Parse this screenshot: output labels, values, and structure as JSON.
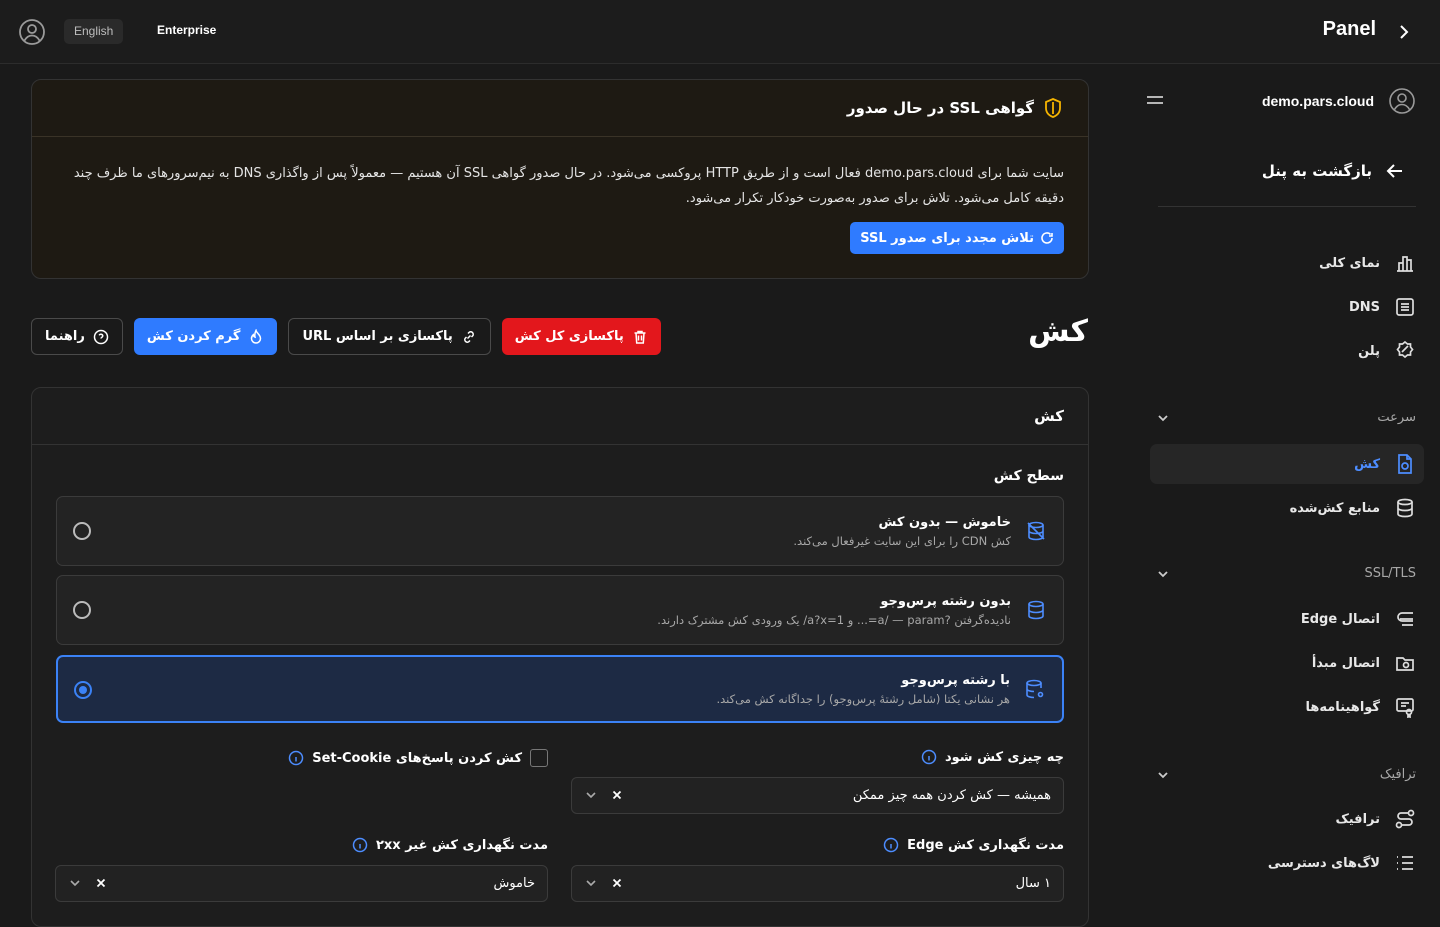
{
  "topbar": {
    "language": "English",
    "plan": "Enterprise",
    "title": "Panel"
  },
  "sidebar": {
    "site": "demo.pars.cloud",
    "back": "بازگشت به پنل",
    "items": [
      {
        "label": "نمای کلی",
        "icon": "chart-icon"
      },
      {
        "label": "DNS",
        "icon": "list-icon"
      },
      {
        "label": "پلن",
        "icon": "badge-icon"
      }
    ],
    "sections": [
      {
        "title": "سرعت",
        "items": [
          {
            "label": "کش",
            "icon": "cache-file-icon",
            "active": true
          },
          {
            "label": "منابع کش‌شده",
            "icon": "database-icon"
          }
        ]
      },
      {
        "title": "SSL/TLS",
        "items": [
          {
            "label": "اتصال Edge",
            "icon": "edge-icon"
          },
          {
            "label": "اتصال مبدأ",
            "icon": "folder-icon"
          },
          {
            "label": "گواهینامه‌ها",
            "icon": "certificate-icon"
          }
        ]
      },
      {
        "title": "ترافیک",
        "items": [
          {
            "label": "ترافیک",
            "icon": "route-icon"
          },
          {
            "label": "لاگ‌های دسترسی",
            "icon": "logs-icon"
          }
        ]
      }
    ]
  },
  "ssl_notice": {
    "title": "گواهی SSL در حال صدور",
    "body": "سایت شما برای demo.pars.cloud فعال است و از طریق HTTP پروکسی می‌شود. در حال صدور گواهی SSL آن هستیم — معمولاً پس از واگذاری DNS به نیم‌سرورهای ما ظرف چند دقیقه کامل می‌شود. تلاش برای صدور به‌صورت خودکار تکرار می‌شود.",
    "retry_button": "تلاش مجدد برای صدور SSL"
  },
  "page": {
    "title": "کش",
    "actions": {
      "purge_all": "پاکسازی کل کش",
      "purge_url": "پاکسازی بر اساس URL",
      "warm": "گرم کردن کش",
      "guide": "راهنما"
    }
  },
  "cache": {
    "card_title": "کش",
    "level_label": "سطح کش",
    "options": [
      {
        "title": "خاموش — بدون کش",
        "desc": "کش CDN را برای این سایت غیرفعال می‌کند.",
        "selected": false
      },
      {
        "title": "بدون رشته پرس‌وجو",
        "desc": "نادیده‌گرفتن ?a/ — param=... و a?x=1/ یک ورودی کش مشترک دارند.",
        "selected": false
      },
      {
        "title": "با رشته پرس‌وجو",
        "desc": "هر نشانی یکتا (شامل رشتهٔ پرس‌وجو) را جداگانه کش می‌کند.",
        "selected": true
      }
    ],
    "what_label": "چه چیزی کش شود",
    "what_value": "همیشه — کش کردن همه چیز ممکن",
    "setcookie_label": "کش کردن پاسخ‌های Set-Cookie",
    "edge_ttl_label": "مدت نگهداری کش Edge",
    "edge_ttl_value": "۱ سال",
    "non2xx_label": "مدت نگهداری کش غیر ۲xx",
    "non2xx_value": "خاموش"
  },
  "colors": {
    "accent": "#2f7bff",
    "danger": "#e3171c",
    "ssl_icon": "#f5b400"
  }
}
